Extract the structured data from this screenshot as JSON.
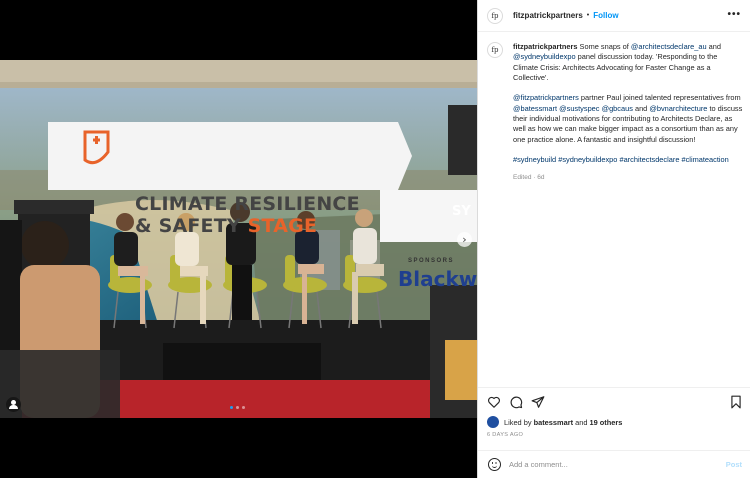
{
  "post": {
    "username": "fitzpatrickpartners",
    "avatar_text": "fp",
    "separator": "•",
    "follow_label": "Follow",
    "more_label": "•••"
  },
  "caption": {
    "username": "fitzpatrickpartners",
    "p1_text1": " Some snaps of ",
    "p1_mention1": "@architectsdeclare_au",
    "p1_text2": " and ",
    "p1_mention2": "@sydneybuildexpo",
    "p1_text3": " panel discussion today. 'Responding to the Climate Crisis: Architects Advocating for Faster Change as a Collective'.",
    "p2_mention1": "@fitzpatrickpartners",
    "p2_text1": " partner Paul joined talented representatives from ",
    "p2_mention2": "@batessmart",
    "p2_mention3": "@sustyspec",
    "p2_mention4": "@gbcaus",
    "p2_text_and": " and ",
    "p2_mention5": "@bvnarchitecture",
    "p2_text2": " to discuss their individual motivations for contributing to Architects Declare, as well as how we can make bigger impact as a consortium than as any one practice alone. A fantastic and insightful discussion!",
    "hashtag1": "#sydneybuild",
    "hashtag2": "#sydneybuildexpo",
    "hashtag3": "#architectsdeclare",
    "hashtag4": "#climateaction",
    "edited": "Edited · 6d"
  },
  "photo": {
    "banner_line1": "CLIMATE RESILIENCE",
    "banner_line2_a": "& SAFETY ",
    "banner_line2_b": "STAGE",
    "sponsor_label": "SPONSORS",
    "sponsor_name": "Blackw",
    "sign_text": "SY"
  },
  "likes": {
    "prefix": "Liked by ",
    "user": "batessmart",
    "mid": " and ",
    "others": "19 others",
    "time": "6 DAYS AGO"
  },
  "comment": {
    "placeholder": "Add a comment...",
    "post_label": "Post"
  },
  "icons": [
    "heart-icon",
    "comment-icon",
    "share-icon",
    "bookmark-icon",
    "emoji-icon",
    "next-arrow-icon",
    "user-tag-icon"
  ],
  "colors": {
    "link": "#00376b",
    "follow": "#0095f6",
    "banner_accent": "#e8632a"
  }
}
